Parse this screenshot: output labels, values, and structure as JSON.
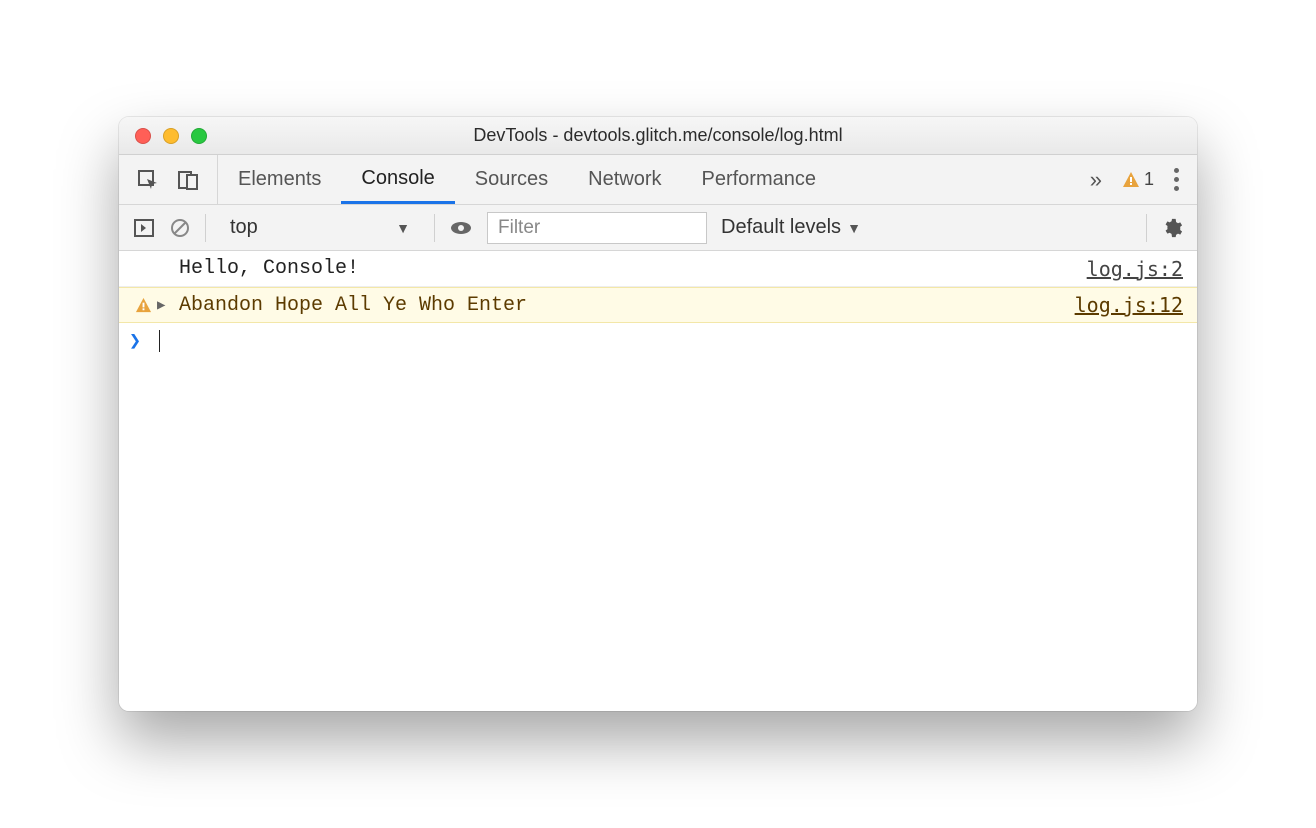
{
  "window": {
    "title": "DevTools - devtools.glitch.me/console/log.html"
  },
  "tabs": {
    "items": [
      "Elements",
      "Console",
      "Sources",
      "Network",
      "Performance"
    ],
    "active_index": 1,
    "overflow_glyph": "»"
  },
  "issues": {
    "warning_count": "1"
  },
  "filterbar": {
    "context_label": "top",
    "filter_placeholder": "Filter",
    "filter_value": "",
    "levels_label": "Default levels"
  },
  "console": {
    "rows": [
      {
        "type": "log",
        "message": "Hello, Console!",
        "source": "log.js:2",
        "expandable": false
      },
      {
        "type": "warn",
        "message": "Abandon Hope All Ye Who Enter",
        "source": "log.js:12",
        "expandable": true
      }
    ]
  },
  "prompt": {
    "glyph": "›"
  }
}
